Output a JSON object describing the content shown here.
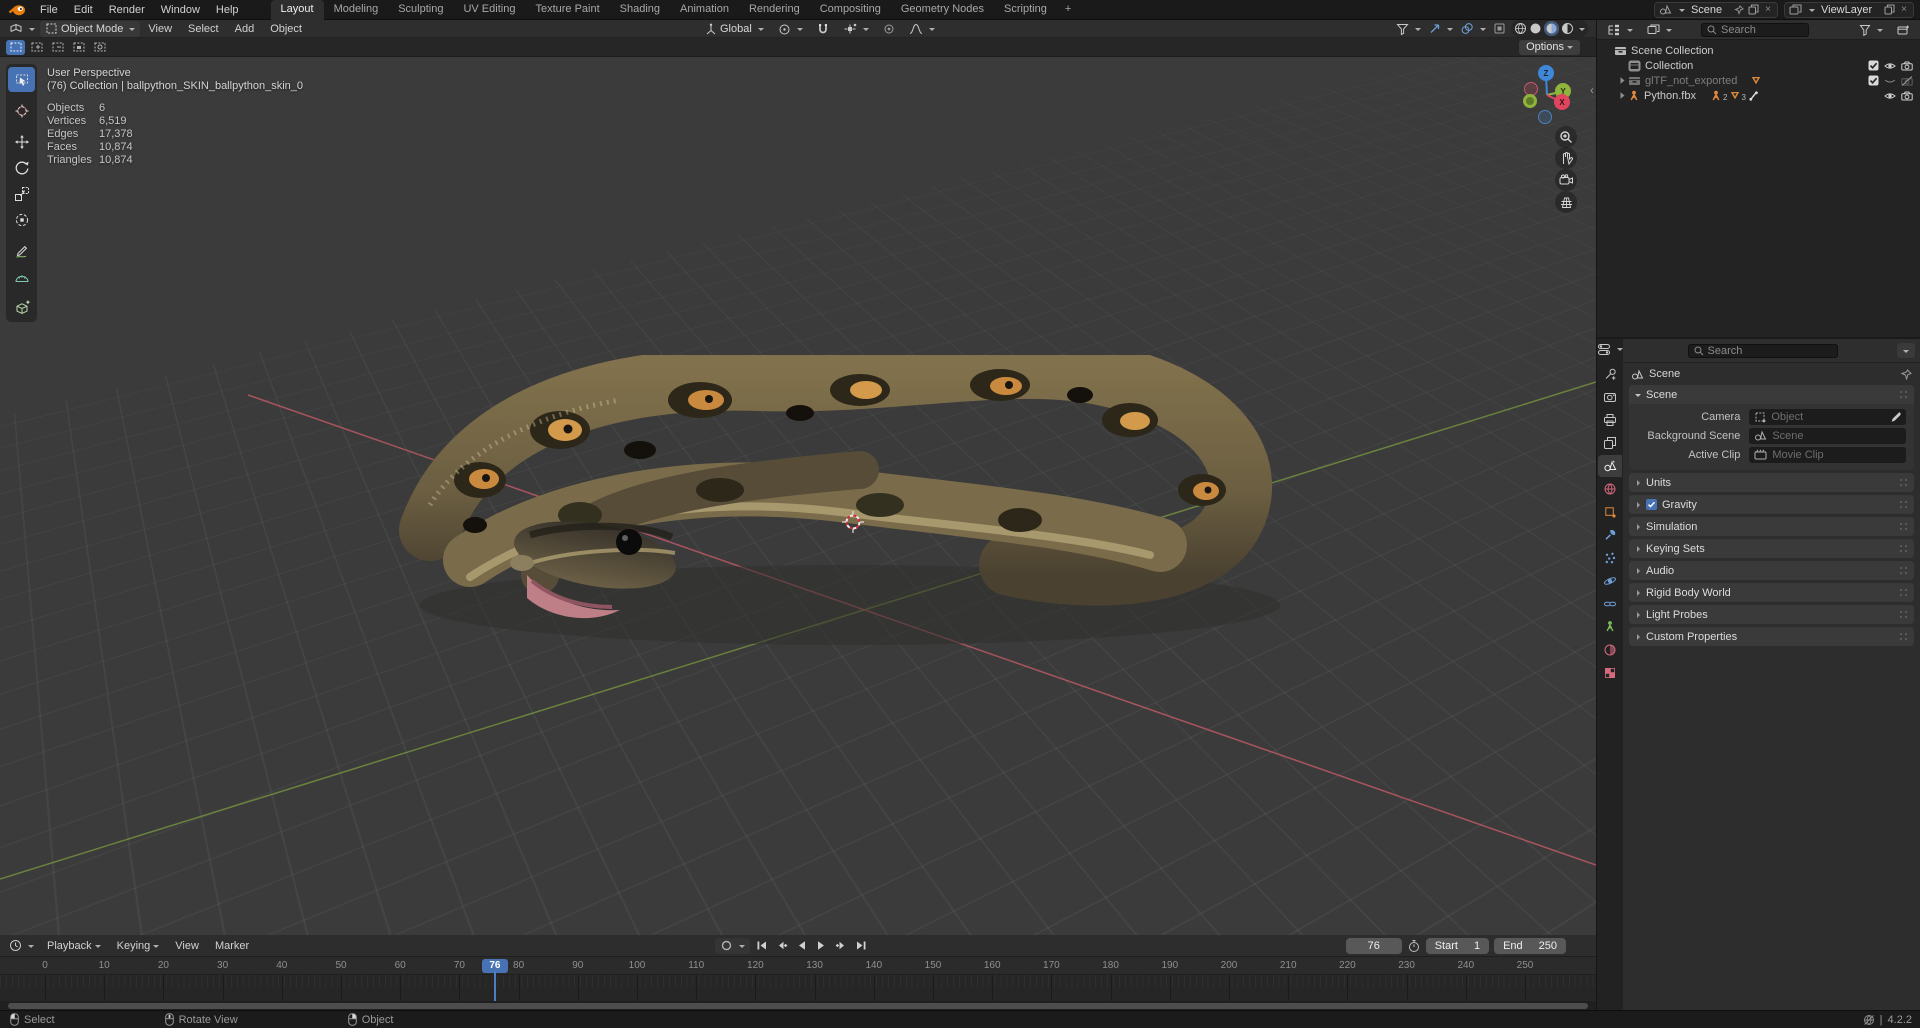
{
  "topbar": {
    "menus": [
      "File",
      "Edit",
      "Render",
      "Window",
      "Help"
    ],
    "workspaces": [
      "Layout",
      "Modeling",
      "Sculpting",
      "UV Editing",
      "Texture Paint",
      "Shading",
      "Animation",
      "Rendering",
      "Compositing",
      "Geometry Nodes",
      "Scripting"
    ],
    "active_workspace": "Layout",
    "add_workspace": "+",
    "scene_selector": "Scene",
    "viewlayer_selector": "ViewLayer"
  },
  "viewport": {
    "mode": "Object Mode",
    "menus": [
      "View",
      "Select",
      "Add",
      "Object"
    ],
    "orientation": "Global",
    "options_button": "Options",
    "toolbar": [
      "select-box",
      "cursor",
      "move",
      "rotate",
      "scale",
      "transform",
      "annotate",
      "measure",
      "add-cube"
    ],
    "overlay": {
      "view_name": "User Perspective",
      "context": "(76) Collection | ballpython_SKIN_ballpython_skin_0",
      "stats": [
        {
          "label": "Objects",
          "value": "6"
        },
        {
          "label": "Vertices",
          "value": "6,519"
        },
        {
          "label": "Edges",
          "value": "17,378"
        },
        {
          "label": "Faces",
          "value": "10,874"
        },
        {
          "label": "Triangles",
          "value": "10,874"
        }
      ]
    },
    "gizmo_axes": {
      "x": "X",
      "y": "Y",
      "z": "Z"
    },
    "colors": {
      "accent": "#4772b3",
      "axis_x": "#bc5a66",
      "axis_y": "#74903f"
    }
  },
  "outliner": {
    "search_placeholder": "Search",
    "rows": [
      {
        "label": "Scene Collection",
        "depth": 0,
        "icon": "collection",
        "expand": false,
        "dim": false,
        "badges": [],
        "toggles": []
      },
      {
        "label": "Collection",
        "depth": 1,
        "icon": "collection-active",
        "expand": false,
        "dim": false,
        "badges": [],
        "toggles": [
          "check",
          "eye",
          "camera"
        ]
      },
      {
        "label": "glTF_not_exported",
        "depth": 1,
        "icon": "collection",
        "expand": true,
        "dim": true,
        "badges": [
          "mesh"
        ],
        "toggles": [
          "check",
          "eye-closed",
          "camera-off"
        ]
      },
      {
        "label": "Python.fbx",
        "depth": 1,
        "icon": "armature",
        "expand": true,
        "dim": false,
        "badges": [
          "armature",
          "num2",
          "mesh",
          "num3",
          "bone"
        ],
        "toggles": [
          "eye",
          "camera"
        ]
      }
    ]
  },
  "properties": {
    "search_placeholder": "Search",
    "breadcrumb": "Scene",
    "tabs": [
      "tool",
      "render",
      "output",
      "view-layer",
      "scene",
      "world",
      "object",
      "modifiers",
      "particles",
      "physics",
      "constraints",
      "data",
      "material",
      "texture"
    ],
    "active_tab": "scene",
    "scene_panel": {
      "label": "Scene",
      "fields": [
        {
          "label": "Camera",
          "placeholder": "Object",
          "icon": "object",
          "eyedropper": true
        },
        {
          "label": "Background Scene",
          "placeholder": "Scene",
          "icon": "scene",
          "eyedropper": false
        },
        {
          "label": "Active Clip",
          "placeholder": "Movie Clip",
          "icon": "clip",
          "eyedropper": false
        }
      ]
    },
    "collapsed_panels": [
      {
        "label": "Units",
        "checkbox": false
      },
      {
        "label": "Gravity",
        "checkbox": true
      },
      {
        "label": "Simulation",
        "checkbox": false
      },
      {
        "label": "Keying Sets",
        "checkbox": false
      },
      {
        "label": "Audio",
        "checkbox": false
      },
      {
        "label": "Rigid Body World",
        "checkbox": false
      },
      {
        "label": "Light Probes",
        "checkbox": false
      },
      {
        "label": "Custom Properties",
        "checkbox": false
      }
    ]
  },
  "timeline": {
    "menus": [
      "Playback",
      "Keying",
      "View",
      "Marker"
    ],
    "current_frame": 76,
    "frame_display": "76",
    "start_label": "Start",
    "start_value": "1",
    "end_label": "End",
    "end_value": "250",
    "ticks": [
      0,
      10,
      20,
      30,
      40,
      50,
      60,
      70,
      80,
      90,
      100,
      110,
      120,
      130,
      140,
      150,
      160,
      170,
      180,
      190,
      200,
      210,
      220,
      230,
      240,
      250
    ]
  },
  "statusbar": {
    "hints": [
      {
        "button": "left",
        "label": "Select"
      },
      {
        "button": "middle",
        "label": "Rotate View"
      },
      {
        "button": "right",
        "label": "Object"
      }
    ],
    "separator": "|",
    "version": "4.2.2"
  }
}
